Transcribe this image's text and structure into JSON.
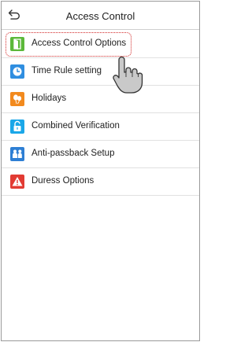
{
  "header": {
    "title": "Access Control",
    "back_icon": "back-arrow-icon"
  },
  "menu": {
    "selected_index": 0,
    "items": [
      {
        "label": "Access Control Options",
        "icon": "door-icon",
        "color": "#5cb83a"
      },
      {
        "label": "Time Rule setting",
        "icon": "clock-icon",
        "color": "#2f8ee0"
      },
      {
        "label": "Holidays",
        "icon": "balloons-icon",
        "color": "#f28a1e"
      },
      {
        "label": "Combined Verification",
        "icon": "unlock-icon",
        "color": "#1aa7e8"
      },
      {
        "label": "Anti-passback Setup",
        "icon": "users-icon",
        "color": "#2e7fd4"
      },
      {
        "label": "Duress Options",
        "icon": "warning-icon",
        "color": "#e23b33"
      }
    ]
  },
  "overlay": {
    "icon": "pointing-hand-icon"
  }
}
